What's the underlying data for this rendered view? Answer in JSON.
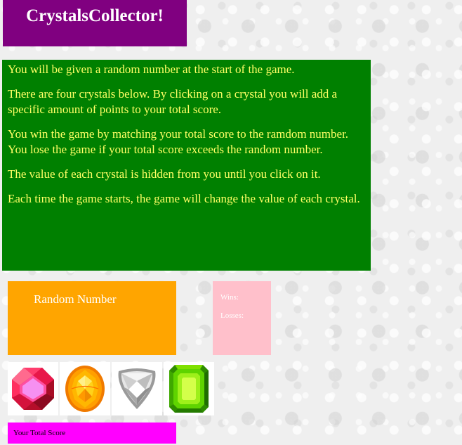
{
  "header": {
    "title": "CrystalsCollector!"
  },
  "instructions": {
    "paragraphs": [
      "You will be given a random number at the start of the game.",
      "There are four crystals below. By clicking on a crystal you will add a specific amount of points to your total score.",
      "You win the game by matching your total score to the ramdom number. You lose the game if your total score exceeds the random number.",
      "The value of each crystal is hidden from you until you click on it.",
      "Each time the game starts, the game will change the value of each crystal."
    ]
  },
  "random_number": {
    "label": "Random Number",
    "value": ""
  },
  "scoreboard": {
    "wins_label": "Wins:",
    "losses_label": "Losses:"
  },
  "crystals": [
    {
      "name": "red-octagon-crystal",
      "icon": "red-gem-icon",
      "color": "#e8174a"
    },
    {
      "name": "orange-oval-crystal",
      "icon": "orange-gem-icon",
      "color": "#ff9f00"
    },
    {
      "name": "white-trillion-crystal",
      "icon": "white-gem-icon",
      "color": "#d4d4d4"
    },
    {
      "name": "green-emerald-crystal",
      "icon": "green-gem-icon",
      "color": "#5fd400"
    }
  ],
  "total_score": {
    "label": "Your Total Score",
    "value": ""
  },
  "colors": {
    "title_bg": "#800080",
    "instructions_bg": "#008000",
    "instructions_text": "#ffff66",
    "random_bg": "#ffa500",
    "scoreboard_bg": "#ffc0cb",
    "total_bg": "#ff00ff"
  }
}
